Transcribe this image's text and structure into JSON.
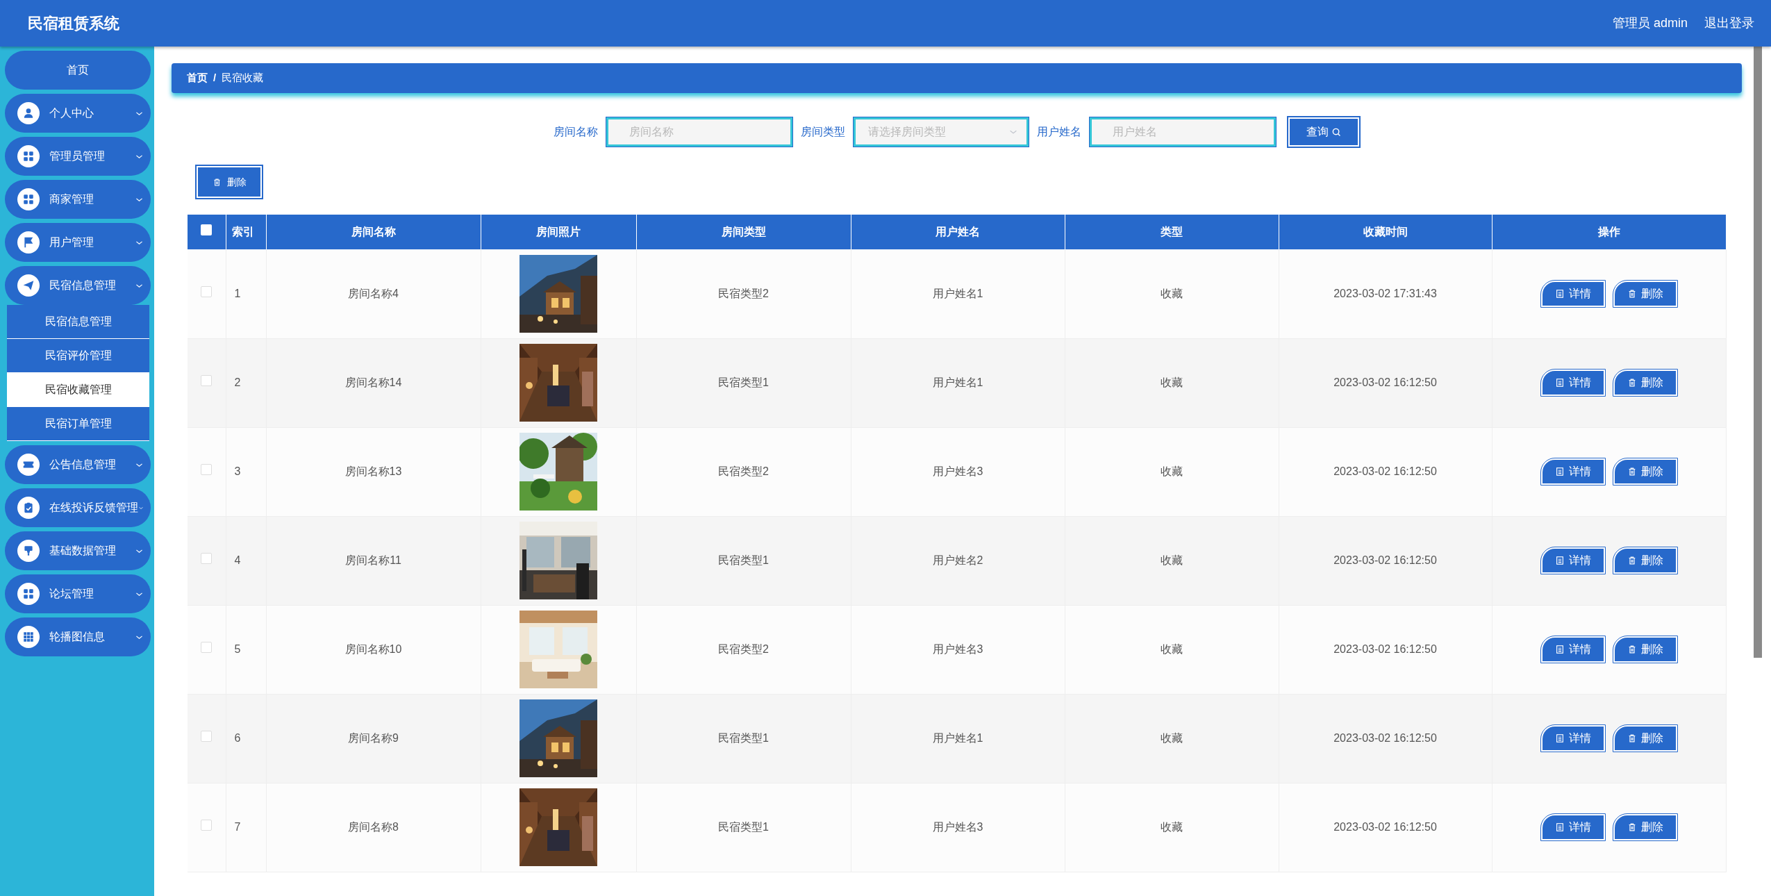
{
  "header": {
    "title": "民宿租赁系统",
    "user": "管理员 admin",
    "logout": "退出登录"
  },
  "sidebar": {
    "items": [
      {
        "label": "首页",
        "kind": "plain"
      },
      {
        "label": "个人中心",
        "kind": "group"
      },
      {
        "label": "管理员管理",
        "kind": "group"
      },
      {
        "label": "商家管理",
        "kind": "group"
      },
      {
        "label": "用户管理",
        "kind": "group"
      },
      {
        "label": "民宿信息管理",
        "kind": "group",
        "children": [
          {
            "label": "民宿信息管理",
            "selected": false
          },
          {
            "label": "民宿评价管理",
            "selected": false
          },
          {
            "label": "民宿收藏管理",
            "selected": true
          },
          {
            "label": "民宿订单管理",
            "selected": false
          }
        ]
      },
      {
        "label": "公告信息管理",
        "kind": "group"
      },
      {
        "label": "在线投诉反馈管理",
        "kind": "group"
      },
      {
        "label": "基础数据管理",
        "kind": "group"
      },
      {
        "label": "论坛管理",
        "kind": "group"
      },
      {
        "label": "轮播图信息",
        "kind": "group"
      }
    ]
  },
  "breadcrumb": {
    "items": [
      "首页",
      "民宿收藏"
    ],
    "separator": "/"
  },
  "search": {
    "fields": [
      {
        "label": "房间名称",
        "kind": "text",
        "placeholder": "房间名称"
      },
      {
        "label": "房间类型",
        "kind": "select",
        "placeholder": "请选择房间类型"
      },
      {
        "label": "用户姓名",
        "kind": "text",
        "placeholder": "用户姓名"
      }
    ],
    "button": "查询"
  },
  "bulk_delete": "删除",
  "table": {
    "select_all": {
      "checked": false
    },
    "columns": [
      "索引",
      "房间名称",
      "房间照片",
      "房间类型",
      "用户姓名",
      "类型",
      "收藏时间",
      "操作"
    ],
    "rows": [
      {
        "checked": false,
        "index": "1",
        "room": "房间名称4",
        "room_type": "民宿类型2",
        "user": "用户姓名1",
        "type": "收藏",
        "time": "2023-03-02 17:31:43",
        "actions": [
          "详情",
          "删除"
        ]
      },
      {
        "checked": false,
        "index": "2",
        "room": "房间名称14",
        "room_type": "民宿类型1",
        "user": "用户姓名1",
        "type": "收藏",
        "time": "2023-03-02 16:12:50",
        "actions": [
          "详情",
          "删除"
        ]
      },
      {
        "checked": false,
        "index": "3",
        "room": "房间名称13",
        "room_type": "民宿类型2",
        "user": "用户姓名3",
        "type": "收藏",
        "time": "2023-03-02 16:12:50",
        "actions": [
          "详情",
          "删除"
        ]
      },
      {
        "checked": false,
        "index": "4",
        "room": "房间名称11",
        "room_type": "民宿类型1",
        "user": "用户姓名2",
        "type": "收藏",
        "time": "2023-03-02 16:12:50",
        "actions": [
          "详情",
          "删除"
        ]
      },
      {
        "checked": false,
        "index": "5",
        "room": "房间名称10",
        "room_type": "民宿类型2",
        "user": "用户姓名3",
        "type": "收藏",
        "time": "2023-03-02 16:12:50",
        "actions": [
          "详情",
          "删除"
        ]
      },
      {
        "checked": false,
        "index": "6",
        "room": "房间名称9",
        "room_type": "民宿类型1",
        "user": "用户姓名1",
        "type": "收藏",
        "time": "2023-03-02 16:12:50",
        "actions": [
          "详情",
          "删除"
        ]
      },
      {
        "checked": false,
        "index": "7",
        "room": "房间名称8",
        "room_type": "民宿类型1",
        "user": "用户姓名3",
        "type": "收藏",
        "time": "2023-03-02 16:12:50",
        "actions": [
          "详情",
          "删除"
        ]
      }
    ]
  }
}
